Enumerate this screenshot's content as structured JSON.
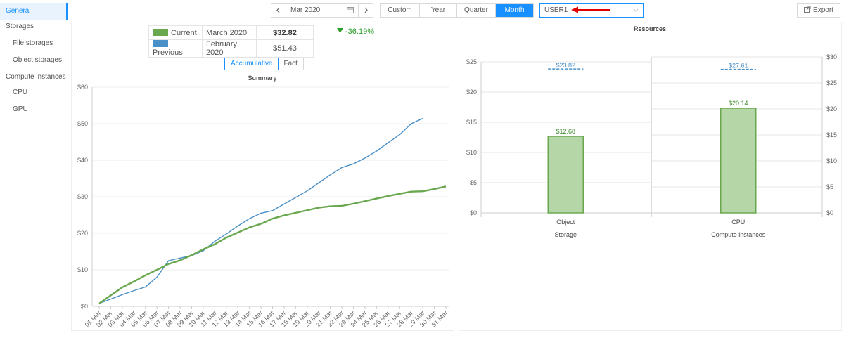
{
  "sidebar": {
    "items": [
      {
        "label": "General",
        "level": 1,
        "active": true
      },
      {
        "label": "Storages",
        "level": 1
      },
      {
        "label": "File storages",
        "level": 2
      },
      {
        "label": "Object storages",
        "level": 2
      },
      {
        "label": "Compute instances",
        "level": 1
      },
      {
        "label": "CPU",
        "level": 2
      },
      {
        "label": "GPU",
        "level": 2
      }
    ]
  },
  "toolbar": {
    "prev_icon": "chevron-left-icon",
    "next_icon": "chevron-right-icon",
    "date_value": "Mar 2020",
    "calendar_icon": "calendar-icon",
    "periods": [
      "Custom",
      "Year",
      "Quarter",
      "Month"
    ],
    "active_period": "Month",
    "user_value": "USER1",
    "export_label": "Export",
    "accent_color": "#1890ff"
  },
  "summary": {
    "legend": [
      {
        "name": "Current",
        "period": "March 2020",
        "value": "$32.82",
        "color": "#6aa84f"
      },
      {
        "name": "Previous",
        "period": "February 2020",
        "value": "$51.43",
        "color": "#4a90c8"
      }
    ],
    "change": "-36.19%",
    "change_color": "#2e9e2e",
    "modes": [
      "Accumulative",
      "Fact"
    ],
    "active_mode": "Accumulative"
  },
  "chart_data": [
    {
      "type": "line",
      "title": "Summary",
      "x": [
        "01 Mar",
        "02 Mar",
        "03 Mar",
        "04 Mar",
        "05 Mar",
        "06 Mar",
        "07 Mar",
        "08 Mar",
        "09 Mar",
        "10 Mar",
        "11 Mar",
        "12 Mar",
        "13 Mar",
        "14 Mar",
        "15 Mar",
        "16 Mar",
        "17 Mar",
        "18 Mar",
        "19 Mar",
        "20 Mar",
        "21 Mar",
        "22 Mar",
        "23 Mar",
        "24 Mar",
        "25 Mar",
        "26 Mar",
        "27 Mar",
        "28 Mar",
        "29 Mar",
        "30 Mar",
        "31 Mar"
      ],
      "ylim": [
        0,
        60
      ],
      "yticks": [
        "$0",
        "$10",
        "$20",
        "$30",
        "$40",
        "$50",
        "$60"
      ],
      "series": [
        {
          "name": "Current",
          "color": "#6aa84f",
          "values": [
            0.8,
            3.0,
            5.2,
            6.8,
            8.5,
            10.0,
            11.6,
            12.6,
            14.0,
            15.6,
            17.0,
            18.8,
            20.2,
            21.6,
            22.6,
            24.0,
            24.9,
            25.6,
            26.3,
            27.0,
            27.4,
            27.5,
            28.1,
            28.8,
            29.5,
            30.2,
            30.8,
            31.4,
            31.5,
            32.1,
            32.82
          ]
        },
        {
          "name": "Previous",
          "color": "#4a90c8",
          "values": [
            0.8,
            2.0,
            3.2,
            4.3,
            5.3,
            8.0,
            12.5,
            13.2,
            13.9,
            15.2,
            17.8,
            19.8,
            22.0,
            24.0,
            25.5,
            26.2,
            28.0,
            29.8,
            31.6,
            33.8,
            36.0,
            38.0,
            39.0,
            40.6,
            42.5,
            44.8,
            47.0,
            50.0,
            51.43
          ]
        }
      ],
      "grid": true
    },
    {
      "type": "bar",
      "title": "Resources",
      "categories": [
        "Object",
        "CPU"
      ],
      "groups": [
        "Storage",
        "Compute instances"
      ],
      "values": [
        12.68,
        20.14
      ],
      "value_labels": [
        "$12.68",
        "$20.14"
      ],
      "previous_values": [
        23.82,
        27.61
      ],
      "previous_labels": [
        "$23.82",
        "$27.61"
      ],
      "left_axis": {
        "ylim": [
          0,
          25
        ],
        "ticks": [
          "$0",
          "$5",
          "$10",
          "$15",
          "$20",
          "$25"
        ]
      },
      "right_axis": {
        "ylim": [
          0,
          30
        ],
        "ticks": [
          "$0",
          "$5",
          "$10",
          "$15",
          "$20",
          "$25",
          "$30"
        ]
      },
      "bar_color": "#b5d6a7",
      "bar_border": "#6aa84f",
      "previous_color": "#4a90c8"
    }
  ]
}
